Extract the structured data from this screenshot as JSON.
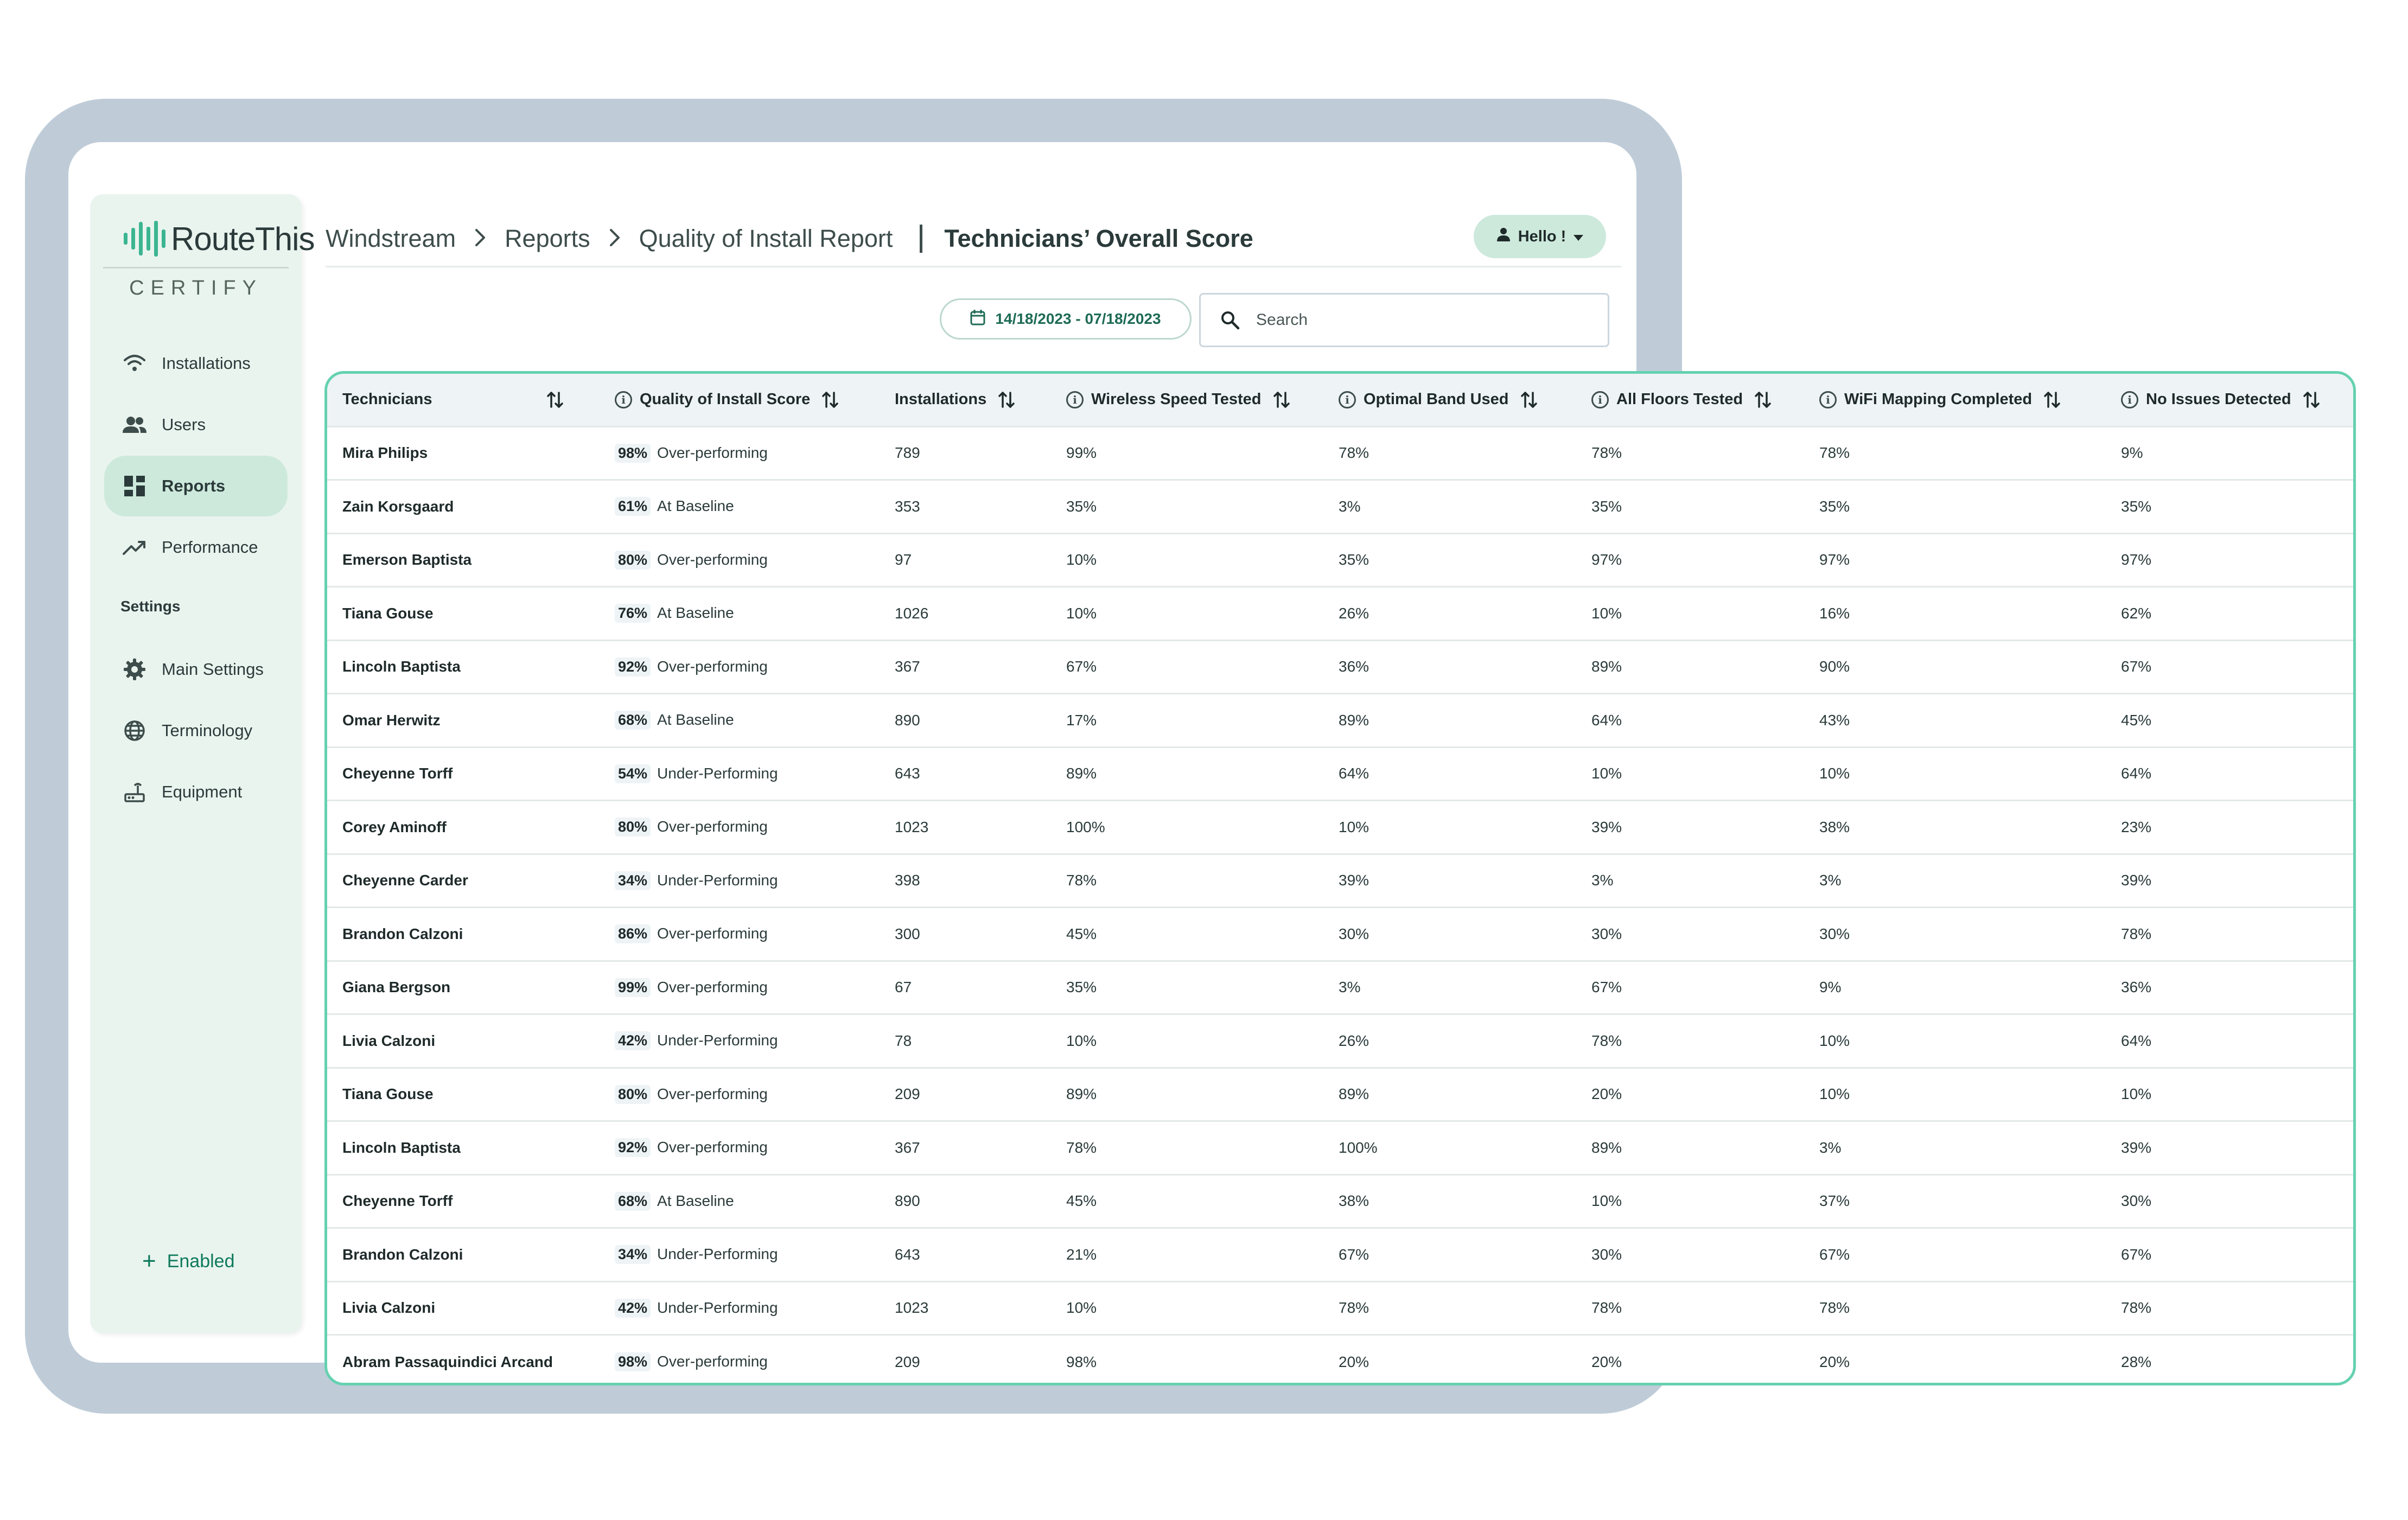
{
  "brand": {
    "name": "RouteThis",
    "product": "CERTIFY"
  },
  "sidebar": {
    "items": [
      {
        "label": "Installations",
        "icon": "wifi-icon",
        "active": false
      },
      {
        "label": "Users",
        "icon": "users-icon",
        "active": false
      },
      {
        "label": "Reports",
        "icon": "dashboard-icon",
        "active": true
      },
      {
        "label": "Performance",
        "icon": "trending-up-icon",
        "active": false
      }
    ],
    "settings_heading": "Settings",
    "settings_items": [
      {
        "label": "Main Settings",
        "icon": "gear-icon"
      },
      {
        "label": "Terminology",
        "icon": "globe-icon"
      },
      {
        "label": "Equipment",
        "icon": "router-icon"
      }
    ],
    "enabled_label": "Enabled"
  },
  "breadcrumb": {
    "items": [
      "Windstream",
      "Reports",
      "Quality of Install Report"
    ],
    "current": "Technicians’ Overall Score"
  },
  "user_menu": {
    "label": "Hello !"
  },
  "filters": {
    "date_range": "14/18/2023 - 07/18/2023",
    "search_placeholder": "Search",
    "search_value": ""
  },
  "colors": {
    "accent": "#65d1b0",
    "sidebar_bg": "#eaf4ef",
    "active_bg": "#cde9dc",
    "frame": "#bfccd8"
  },
  "table": {
    "columns": [
      {
        "label": "Technicians",
        "info": false,
        "sortable": true
      },
      {
        "label": "Quality of Install Score",
        "info": true,
        "sortable": true
      },
      {
        "label": "Installations",
        "info": false,
        "sortable": true
      },
      {
        "label": "Wireless Speed Tested",
        "info": true,
        "sortable": true
      },
      {
        "label": "Optimal Band Used",
        "info": true,
        "sortable": true
      },
      {
        "label": "All Floors Tested",
        "info": true,
        "sortable": true
      },
      {
        "label": "WiFi Mapping Completed",
        "info": true,
        "sortable": true
      },
      {
        "label": "No Issues Detected",
        "info": true,
        "sortable": true
      }
    ],
    "rows": [
      {
        "name": "Mira Philips",
        "score": "98%",
        "status": "Over-performing",
        "installations": "789",
        "wireless": "99%",
        "band": "78%",
        "floors": "78%",
        "mapping": "78%",
        "issues": "9%"
      },
      {
        "name": "Zain Korsgaard",
        "score": "61%",
        "status": "At Baseline",
        "installations": "353",
        "wireless": "35%",
        "band": "3%",
        "floors": "35%",
        "mapping": "35%",
        "issues": "35%"
      },
      {
        "name": "Emerson Baptista",
        "score": "80%",
        "status": "Over-performing",
        "installations": "97",
        "wireless": "10%",
        "band": "35%",
        "floors": "97%",
        "mapping": "97%",
        "issues": "97%"
      },
      {
        "name": "Tiana Gouse",
        "score": "76%",
        "status": "At Baseline",
        "installations": "1026",
        "wireless": "10%",
        "band": "26%",
        "floors": "10%",
        "mapping": "16%",
        "issues": "62%"
      },
      {
        "name": "Lincoln Baptista",
        "score": "92%",
        "status": "Over-performing",
        "installations": "367",
        "wireless": "67%",
        "band": "36%",
        "floors": "89%",
        "mapping": "90%",
        "issues": "67%"
      },
      {
        "name": "Omar Herwitz",
        "score": "68%",
        "status": "At Baseline",
        "installations": "890",
        "wireless": "17%",
        "band": "89%",
        "floors": "64%",
        "mapping": "43%",
        "issues": "45%"
      },
      {
        "name": "Cheyenne Torff",
        "score": "54%",
        "status": "Under-Performing",
        "installations": "643",
        "wireless": "89%",
        "band": "64%",
        "floors": "10%",
        "mapping": "10%",
        "issues": "64%"
      },
      {
        "name": "Corey Aminoff",
        "score": "80%",
        "status": "Over-performing",
        "installations": "1023",
        "wireless": "100%",
        "band": "10%",
        "floors": "39%",
        "mapping": "38%",
        "issues": "23%"
      },
      {
        "name": "Cheyenne Carder",
        "score": "34%",
        "status": "Under-Performing",
        "installations": "398",
        "wireless": "78%",
        "band": "39%",
        "floors": "3%",
        "mapping": "3%",
        "issues": "39%"
      },
      {
        "name": "Brandon Calzoni",
        "score": "86%",
        "status": "Over-performing",
        "installations": "300",
        "wireless": "45%",
        "band": "30%",
        "floors": "30%",
        "mapping": "30%",
        "issues": "78%"
      },
      {
        "name": "Giana Bergson",
        "score": "99%",
        "status": "Over-performing",
        "installations": "67",
        "wireless": "35%",
        "band": "3%",
        "floors": "67%",
        "mapping": "9%",
        "issues": "36%"
      },
      {
        "name": "Livia Calzoni",
        "score": "42%",
        "status": "Under-Performing",
        "installations": "78",
        "wireless": "10%",
        "band": "26%",
        "floors": "78%",
        "mapping": "10%",
        "issues": "64%"
      },
      {
        "name": "Tiana Gouse",
        "score": "80%",
        "status": "Over-performing",
        "installations": "209",
        "wireless": "89%",
        "band": "89%",
        "floors": "20%",
        "mapping": "10%",
        "issues": "10%"
      },
      {
        "name": "Lincoln Baptista",
        "score": "92%",
        "status": "Over-performing",
        "installations": "367",
        "wireless": "78%",
        "band": "100%",
        "floors": "89%",
        "mapping": "3%",
        "issues": "39%"
      },
      {
        "name": "Cheyenne Torff",
        "score": "68%",
        "status": "At Baseline",
        "installations": "890",
        "wireless": "45%",
        "band": "38%",
        "floors": "10%",
        "mapping": "37%",
        "issues": "30%"
      },
      {
        "name": "Brandon Calzoni",
        "score": "34%",
        "status": "Under-Performing",
        "installations": "643",
        "wireless": "21%",
        "band": "67%",
        "floors": "30%",
        "mapping": "67%",
        "issues": "67%"
      },
      {
        "name": "Livia Calzoni",
        "score": "42%",
        "status": "Under-Performing",
        "installations": "1023",
        "wireless": "10%",
        "band": "78%",
        "floors": "78%",
        "mapping": "78%",
        "issues": "78%"
      },
      {
        "name": "Abram Passaquindici Arcand",
        "score": "98%",
        "status": "Over-performing",
        "installations": "209",
        "wireless": "98%",
        "band": "20%",
        "floors": "20%",
        "mapping": "20%",
        "issues": "28%"
      }
    ]
  }
}
